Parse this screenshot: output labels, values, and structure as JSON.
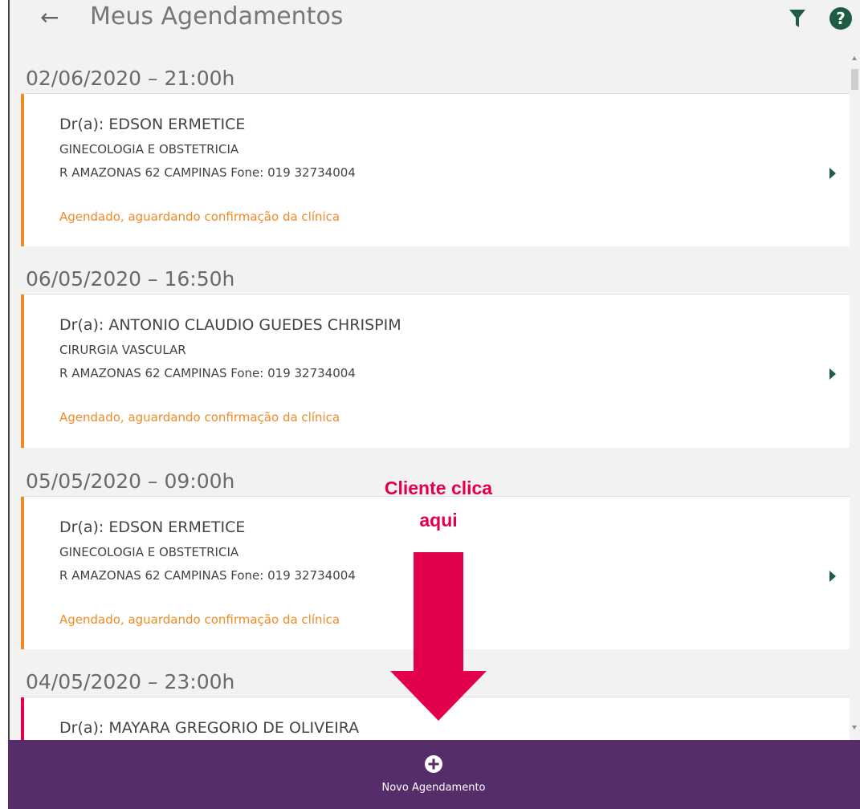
{
  "header": {
    "title": "Meus Agendamentos",
    "back_icon": "back-arrow-icon",
    "filter_icon": "filter-icon",
    "help_icon": "help-icon"
  },
  "appointments": [
    {
      "date": "02/06/2020 – 21:00h",
      "doctor": "Dr(a): EDSON ERMETICE",
      "specialty": "GINECOLOGIA E OBSTETRICIA",
      "address": "R AMAZONAS 62  CAMPINAS Fone: 019 32734004",
      "status": "Agendado, aguardando confirmação da clínica",
      "stripe_color": "#f08a24"
    },
    {
      "date": "06/05/2020 – 16:50h",
      "doctor": "Dr(a): ANTONIO CLAUDIO GUEDES CHRISPIM",
      "specialty": "CIRURGIA VASCULAR",
      "address": "R AMAZONAS 62  CAMPINAS Fone: 019 32734004",
      "status": "Agendado, aguardando confirmação da clínica",
      "stripe_color": "#f08a24"
    },
    {
      "date": "05/05/2020 – 09:00h",
      "doctor": "Dr(a): EDSON ERMETICE",
      "specialty": "GINECOLOGIA E OBSTETRICIA",
      "address": "R AMAZONAS 62  CAMPINAS Fone: 019 32734004",
      "status": "Agendado, aguardando confirmação da clínica",
      "stripe_color": "#f08a24"
    },
    {
      "date": "04/05/2020 – 23:00h",
      "doctor": "Dr(a): MAYARA GREGORIO DE OLIVEIRA",
      "stripe_color": "#e3004a"
    }
  ],
  "bottom_bar": {
    "new_appointment_label": "Novo Agendamento",
    "icon": "plus-circle-icon",
    "color": "#542d6a"
  },
  "annotation": {
    "text_line1": "Cliente clica",
    "text_line2": "aqui",
    "color": "#e3004a"
  },
  "colors": {
    "accent_status": "#f08a24",
    "chevron": "#1f5c44"
  }
}
